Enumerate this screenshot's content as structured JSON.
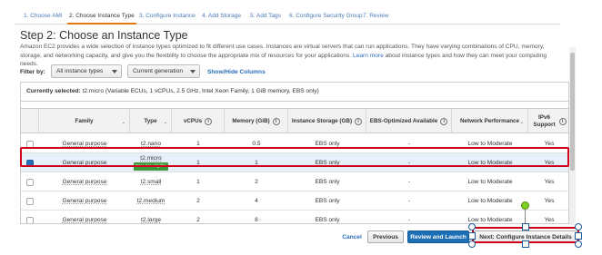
{
  "wizard": {
    "tabs": [
      {
        "label": "1. Choose AMI",
        "active": false
      },
      {
        "label": "2. Choose Instance Type",
        "active": true
      },
      {
        "label": "3. Configure Instance",
        "active": false
      },
      {
        "label": "4. Add Storage",
        "active": false
      },
      {
        "label": "5. Add Tags",
        "active": false
      },
      {
        "label": "6. Configure Security Group",
        "active": false
      },
      {
        "label": "7. Review",
        "active": false
      }
    ]
  },
  "page": {
    "title": "Step 2: Choose an Instance Type",
    "description": "Amazon EC2 provides a wide selection of instance types optimized to fit different use cases. Instances are virtual servers that can run applications. They have varying combinations of CPU, memory, storage, and networking capacity, and give you the flexibility to choose the appropriate mix of resources for your applications.",
    "learn_more": "Learn more",
    "description_tail": "about instance types and how they can meet your computing needs."
  },
  "filter": {
    "label": "Filter by:",
    "type_select": "All instance types",
    "generation_select": "Current generation",
    "show_hide": "Show/Hide Columns"
  },
  "current_selection": {
    "label": "Currently selected:",
    "value": "t2.micro (Variable ECUs, 1 vCPUs, 2.5 GHz, Intel Xeon Family, 1 GiB memory, EBS only)"
  },
  "table": {
    "columns": [
      "Family",
      "Type",
      "vCPUs",
      "Memory (GiB)",
      "Instance Storage (GB)",
      "EBS-Optimized Available",
      "Network Performance",
      "IPv6 Support"
    ],
    "free_tier_badge": "Free tier eligible",
    "rows": [
      {
        "family": "General purpose",
        "type": "t2.nano",
        "vcpus": "1",
        "memory": "0.5",
        "storage": "EBS only",
        "ebs_opt": "-",
        "network": "Low to Moderate",
        "ipv6": "Yes",
        "selected": false,
        "free": false
      },
      {
        "family": "General purpose",
        "type": "t2.micro",
        "vcpus": "1",
        "memory": "1",
        "storage": "EBS only",
        "ebs_opt": "-",
        "network": "Low to Moderate",
        "ipv6": "Yes",
        "selected": true,
        "free": true
      },
      {
        "family": "General purpose",
        "type": "t2.small",
        "vcpus": "1",
        "memory": "2",
        "storage": "EBS only",
        "ebs_opt": "-",
        "network": "Low to Moderate",
        "ipv6": "Yes",
        "selected": false,
        "free": false
      },
      {
        "family": "General purpose",
        "type": "t2.medium",
        "vcpus": "2",
        "memory": "4",
        "storage": "EBS only",
        "ebs_opt": "-",
        "network": "Low to Moderate",
        "ipv6": "Yes",
        "selected": false,
        "free": false
      },
      {
        "family": "General purpose",
        "type": "t2.large",
        "vcpus": "2",
        "memory": "8",
        "storage": "EBS only",
        "ebs_opt": "-",
        "network": "Low to Moderate",
        "ipv6": "Yes",
        "selected": false,
        "free": false
      }
    ]
  },
  "footer": {
    "cancel": "Cancel",
    "previous": "Previous",
    "review": "Review and Launch",
    "next": "Next: Configure Instance Details"
  },
  "colors": {
    "accent": "#e47911",
    "link": "#2a6ebb",
    "primary_button": "#1d6fb5",
    "highlight": "#d0021b",
    "free_tier": "#3c9a3c"
  }
}
